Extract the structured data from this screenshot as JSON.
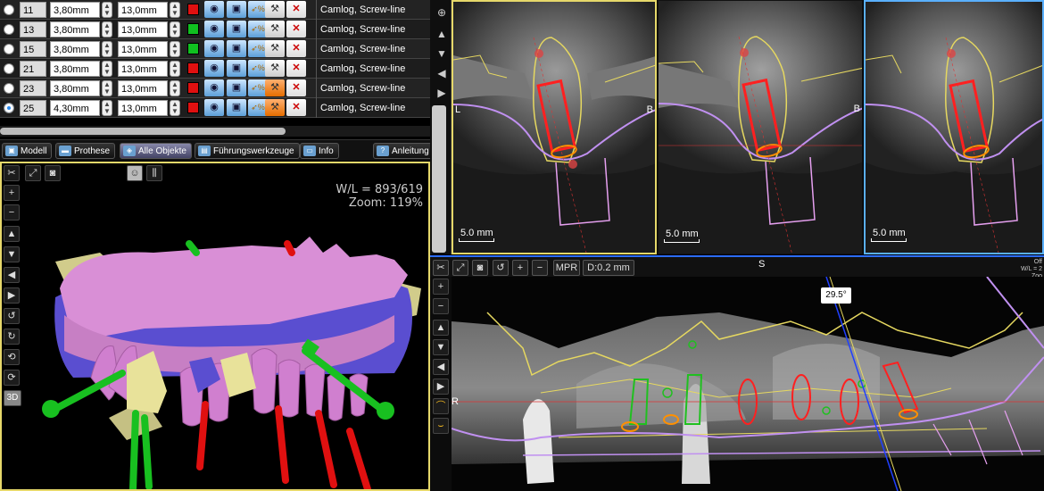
{
  "implants": [
    {
      "id": "11",
      "diameter": "3,80mm",
      "length": "13,0mm",
      "color": "#e01010",
      "manufacturer": "Camlog, Screw-line",
      "selected": false,
      "guide": "white"
    },
    {
      "id": "13",
      "diameter": "3,80mm",
      "length": "13,0mm",
      "color": "#10c020",
      "manufacturer": "Camlog, Screw-line",
      "selected": false,
      "guide": "white"
    },
    {
      "id": "15",
      "diameter": "3,80mm",
      "length": "13,0mm",
      "color": "#10c020",
      "manufacturer": "Camlog, Screw-line",
      "selected": false,
      "guide": "white"
    },
    {
      "id": "21",
      "diameter": "3,80mm",
      "length": "13,0mm",
      "color": "#e01010",
      "manufacturer": "Camlog, Screw-line",
      "selected": false,
      "guide": "white"
    },
    {
      "id": "23",
      "diameter": "3,80mm",
      "length": "13,0mm",
      "color": "#e01010",
      "manufacturer": "Camlog, Screw-line",
      "selected": false,
      "guide": "orange"
    },
    {
      "id": "25",
      "diameter": "4,30mm",
      "length": "13,0mm",
      "color": "#e01010",
      "manufacturer": "Camlog, Screw-line",
      "selected": true,
      "guide": "orange"
    }
  ],
  "tabs": {
    "modell": "Modell",
    "prothese": "Prothese",
    "alle_objekte": "Alle Objekte",
    "fuehrungswerkzeuge": "Führungswerkzeuge",
    "info": "Info",
    "anleitung": "Anleitung"
  },
  "view3d": {
    "wl": "W/L = 893/619",
    "zoom": "Zoom: 119%",
    "mode_label": "3D"
  },
  "cross_sections": {
    "scale_label": "5.0 mm",
    "left_marker": "L",
    "right_marker": "B"
  },
  "panoramic": {
    "mpr_label": "MPR",
    "distance_label": "D:0.2 mm",
    "angle_label": "29.5°",
    "top_marker": "S",
    "right_marker": "R",
    "wl_text": "W/L = 2",
    "zoom_text": "Zoo",
    "off_text": "Off"
  },
  "icons": {
    "tools": "scissors-icon",
    "fit": "fit-icon",
    "camera": "camera-icon",
    "zoom_in": "zoom-in-icon",
    "zoom_out": "zoom-out-icon"
  }
}
